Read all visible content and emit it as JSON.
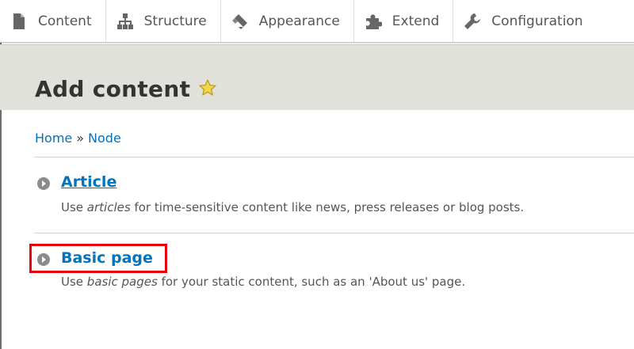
{
  "toolbar": {
    "items": [
      {
        "label": "Content",
        "icon": "page-icon"
      },
      {
        "label": "Structure",
        "icon": "sitemap-icon"
      },
      {
        "label": "Appearance",
        "icon": "paintbrush-icon"
      },
      {
        "label": "Extend",
        "icon": "puzzle-icon"
      },
      {
        "label": "Configuration",
        "icon": "wrench-icon"
      }
    ]
  },
  "header": {
    "title": "Add content",
    "shortcut_icon": "star-icon"
  },
  "breadcrumb": {
    "items": [
      "Home",
      "Node"
    ],
    "separator": "»"
  },
  "content_types": [
    {
      "name": "Article",
      "desc_pre": "Use ",
      "desc_em": "articles",
      "desc_post": " for time-sensitive content like news, press releases or blog posts."
    },
    {
      "name": "Basic page",
      "desc_pre": "Use ",
      "desc_em": "basic pages",
      "desc_post": " for your static content, such as an 'About us' page."
    }
  ],
  "colors": {
    "link": "#0074bd",
    "header_bg": "#e1e1dc",
    "highlight": "#e8000b",
    "star": "#f0d84a"
  }
}
